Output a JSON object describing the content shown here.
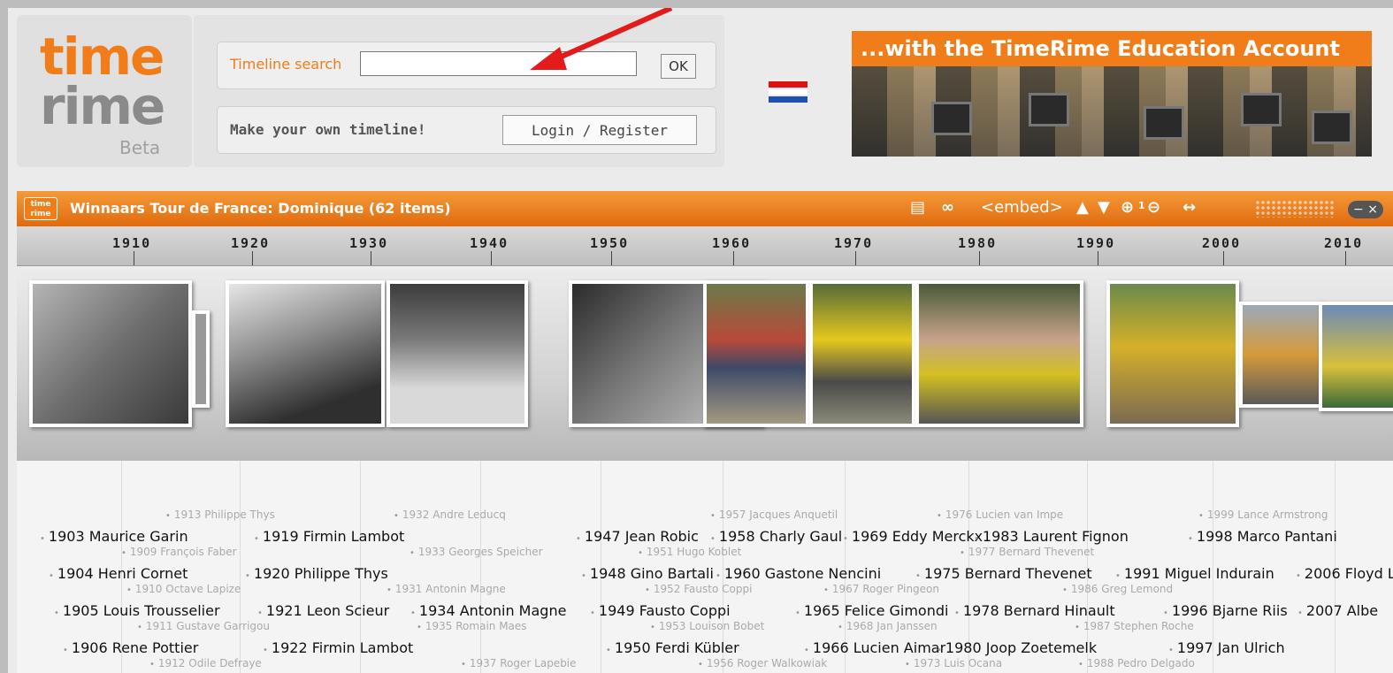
{
  "logo": {
    "line1": "time",
    "line2": "rime",
    "beta": "Beta"
  },
  "search": {
    "label": "Timeline search",
    "value": "",
    "ok_label": "OK"
  },
  "account": {
    "label": "Make your own timeline!",
    "login_label": "Login / Register"
  },
  "banner": {
    "title": "...with the TimeRime Education Account"
  },
  "timeline": {
    "logo_line1": "time",
    "logo_line2": "rime",
    "title": "Winnaars Tour de France: Dominique  (62 items)",
    "embed_label": "<embed>",
    "zoom_level": "1",
    "years": [
      "1910",
      "1920",
      "1930",
      "1940",
      "1950",
      "1960",
      "1970",
      "1980",
      "1990",
      "2000",
      "2010"
    ]
  },
  "events_main": [
    "1903 Maurice Garin",
    "1919 Firmin Lambot",
    "1904 Henri Cornet",
    "1920 Philippe Thys",
    "1905 Louis Trousselier",
    "1921 Leon Scieur",
    "1934 Antonin Magne",
    "1906 Rene Pottier",
    "1922 Firmin Lambot",
    "1947 Jean Robic",
    "1958 Charly Gaul",
    "1969 Eddy Merckx",
    "1983 Laurent Fignon",
    "1998 Marco Pantani",
    "1948 Gino Bartali",
    "1960 Gastone Nencini",
    "1975 Bernard Thevenet",
    "1991 Miguel Indurain",
    "2006 Floyd L",
    "1949 Fausto Coppi",
    "1965 Felice Gimondi",
    "1978 Bernard Hinault",
    "1996 Bjarne Riis",
    "2007 Albe",
    "1950 Ferdi Kübler",
    "1966 Lucien Aimar",
    "1980 Joop Zoetemelk",
    "1997 Jan Ulrich"
  ],
  "events_sub": [
    "1913 Philippe Thys",
    "1932 Andre Leducq",
    "1909 François Faber",
    "1933 Georges Speicher",
    "1910 Octave Lapize",
    "1931 Antonin Magne",
    "1911 Gustave Garrigou",
    "1935 Romain Maes",
    "1912 Odile Defraye",
    "1937 Roger Lapebie",
    "1957 Jacques Anquetil",
    "1951 Hugo Koblet",
    "1952 Fausto Coppi",
    "1953 Louison Bobet",
    "1956 Roger Walkowiak",
    "1976 Lucien van Impe",
    "1977 Bernard Thevenet",
    "1967 Roger Pingeon",
    "1968 Jan Janssen",
    "1973 Luis Ocana",
    "1986 Greg Lemond",
    "1987 Stephen Roche",
    "1988 Pedro Delgado",
    "1999 Lance Armstrong"
  ],
  "colors": {
    "brand_orange": "#f07d1a",
    "arrow_red": "#e31b1b"
  }
}
